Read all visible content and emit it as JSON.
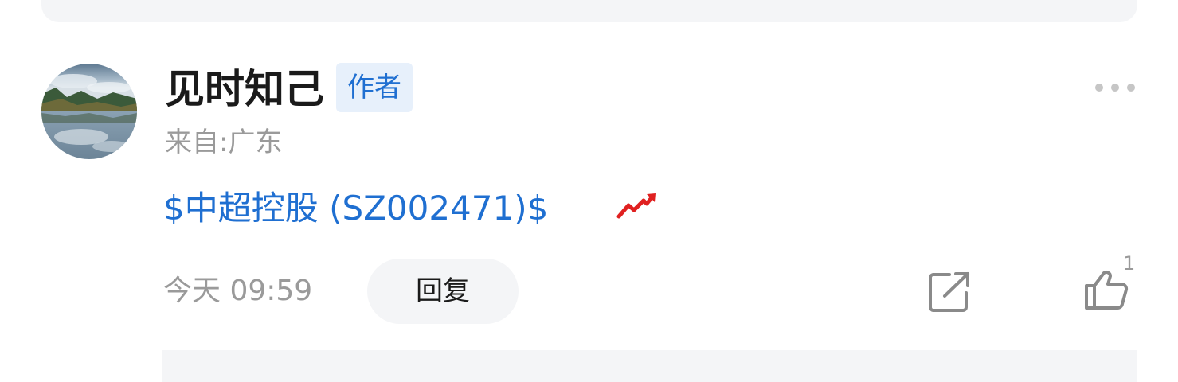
{
  "post": {
    "author": {
      "name": "见时知己",
      "badge": "作者",
      "location": "来自:广东",
      "avatar_icon": "landscape-avatar"
    },
    "content": {
      "stock_link": "$中超控股 (SZ002471)$",
      "trend_icon": "stock-up-trend-icon"
    },
    "footer": {
      "timestamp": "今天 09:59",
      "reply_label": "回复",
      "share_icon": "share-icon",
      "like_icon": "thumbs-up-icon",
      "like_count": "1"
    }
  },
  "colors": {
    "link_blue": "#1f6fd1",
    "badge_bg": "#e7f0fb",
    "muted_gray": "#9a9a9a",
    "panel_gray": "#f4f5f7",
    "trend_red": "#e02020"
  }
}
